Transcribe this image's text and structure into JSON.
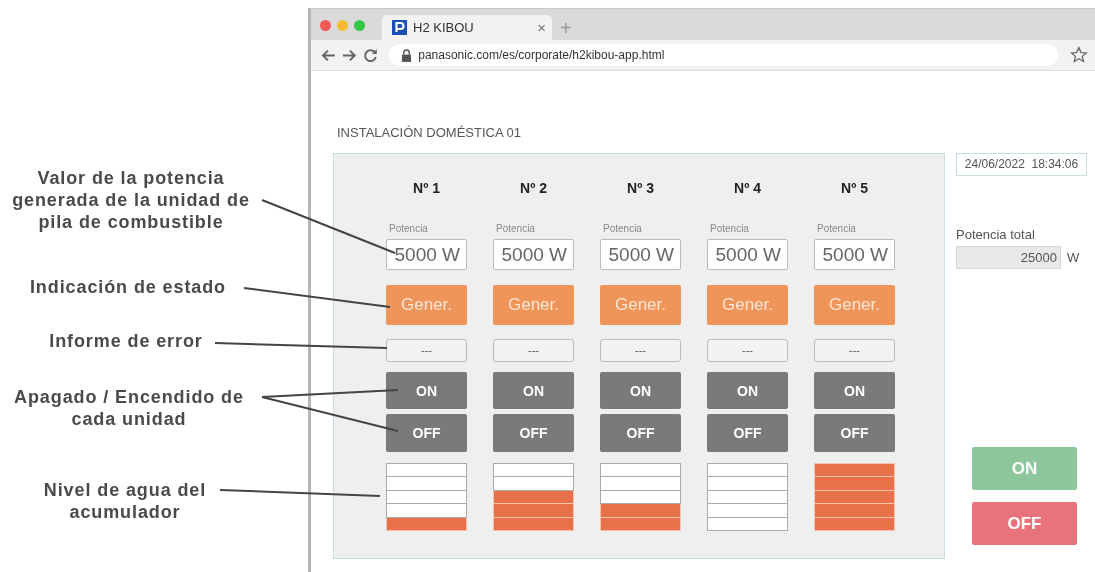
{
  "annotations": [
    {
      "text": "Valor de la potencia generada de la unidad de pila de combustible"
    },
    {
      "text": "Indicación de estado"
    },
    {
      "text": "Informe de error"
    },
    {
      "text": "Apagado / Encendido de cada unidad"
    },
    {
      "text": "Nivel de agua del acumulador"
    }
  ],
  "browser": {
    "tab_title": "H2 KIBOU",
    "new_tab": "+",
    "close_tab": "×",
    "url": "panasonic.com/es/corporate/h2kibou-app.html"
  },
  "page": {
    "title": "INSTALACIÓN DOMÉSTICA 01",
    "datetime": "24/06/2022  18:34:06",
    "total_label": "Potencia total",
    "total_value": "25000",
    "total_unit": "W",
    "on_button": "ON",
    "off_button": "OFF"
  },
  "units": [
    {
      "label": "Nº 1",
      "power_label": "Potencia",
      "power": "5000 W",
      "status": "Gener.",
      "error": "---",
      "on_button": "ON",
      "off_button": "OFF",
      "water_level": [
        {
          "filled": false
        },
        {
          "filled": false
        },
        {
          "filled": false
        },
        {
          "filled": false
        },
        {
          "filled": true
        }
      ]
    },
    {
      "label": "Nº 2",
      "power_label": "Potencia",
      "power": "5000 W",
      "status": "Gener.",
      "error": "---",
      "on_button": "ON",
      "off_button": "OFF",
      "water_level": [
        {
          "filled": false
        },
        {
          "filled": false
        },
        {
          "filled": true
        },
        {
          "filled": true
        },
        {
          "filled": true
        }
      ]
    },
    {
      "label": "Nº 3",
      "power_label": "Potencia",
      "power": "5000 W",
      "status": "Gener.",
      "error": "---",
      "on_button": "ON",
      "off_button": "OFF",
      "water_level": [
        {
          "filled": false
        },
        {
          "filled": false
        },
        {
          "filled": false
        },
        {
          "filled": true
        },
        {
          "filled": true
        }
      ]
    },
    {
      "label": "Nº 4",
      "power_label": "Potencia",
      "power": "5000 W",
      "status": "Gener.",
      "error": "---",
      "on_button": "ON",
      "off_button": "OFF",
      "water_level": [
        {
          "filled": false
        },
        {
          "filled": false
        },
        {
          "filled": false
        },
        {
          "filled": false
        },
        {
          "filled": false
        }
      ]
    },
    {
      "label": "Nº 5",
      "power_label": "Potencia",
      "power": "5000 W",
      "status": "Gener.",
      "error": "---",
      "on_button": "ON",
      "off_button": "OFF",
      "water_level": [
        {
          "filled": true
        },
        {
          "filled": true
        },
        {
          "filled": true
        },
        {
          "filled": true
        },
        {
          "filled": true
        }
      ]
    }
  ]
}
